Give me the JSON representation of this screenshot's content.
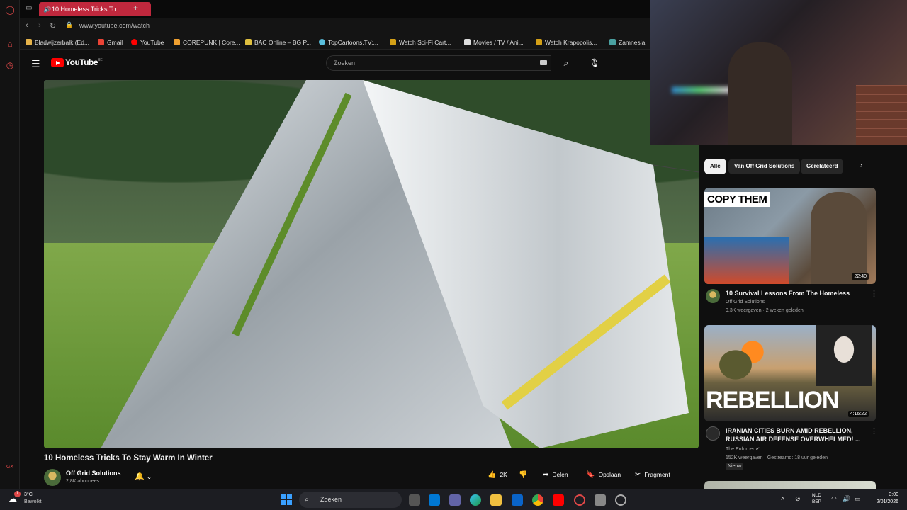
{
  "browser": {
    "tab_title": "10 Homeless Tricks To",
    "url": "www.youtube.com/watch",
    "bookmarks": [
      {
        "label": "Bladwijzerbalk (Ed...",
        "color": "#e6b34a"
      },
      {
        "label": "Gmail",
        "color": "#ea4335"
      },
      {
        "label": "YouTube",
        "color": "#ff0000"
      },
      {
        "label": "COREPUNK | Core...",
        "color": "#f0a030"
      },
      {
        "label": "BAC Online – BG P...",
        "color": "#e0c040"
      },
      {
        "label": "TopCartoons.TV:...",
        "color": "#5bc0de"
      },
      {
        "label": "Watch Sci-Fi Cart...",
        "color": "#d4a017"
      },
      {
        "label": "Movies / TV / Ani...",
        "color": "#dddddd"
      },
      {
        "label": "Watch Krapopolis...",
        "color": "#d4a017"
      },
      {
        "label": "Zamnesia",
        "color": "#4aa0a0"
      }
    ]
  },
  "youtube": {
    "logo_text": "YouTube",
    "country_code": "BE",
    "search_placeholder": "Zoeken"
  },
  "video": {
    "title": "10 Homeless Tricks To Stay Warm In Winter",
    "channel_name": "Off Grid Solutions",
    "channel_subs": "2,8K abonnees",
    "like_count": "2K",
    "share_label": "Delen",
    "save_label": "Opslaan",
    "clip_label": "Fragment",
    "more_label": "···"
  },
  "chips": [
    {
      "label": "Alle",
      "active": true
    },
    {
      "label": "Van Off Grid Solutions",
      "active": false
    },
    {
      "label": "Gerelateerd",
      "active": false
    }
  ],
  "recommendations": [
    {
      "title": "10 Survival Lessons From The Homeless",
      "channel": "Off Grid Solutions",
      "meta": "9,3K weergaven · 2 weken geleden",
      "duration": "22:40",
      "thumb_text": "COPY THEM"
    },
    {
      "title": "IRANIAN CITIES BURN AMID REBELLION, RUSSIAN AIR DEFENSE OVERWHELMED! ...",
      "channel": "The Enforcer",
      "meta": "152K weergaven · Gestreamd: 18 uur geleden",
      "badge": "Nieuw",
      "duration": "4:16:22",
      "thumb_text": "REBELLION"
    }
  ],
  "taskbar": {
    "weather_temp": "3°C",
    "weather_desc": "Bewolkt",
    "weather_badge": "1",
    "search_label": "Zoeken",
    "lang_top": "NLD",
    "lang_bottom": "BEP",
    "time": "3:00",
    "date": "2/01/2026"
  },
  "colors": {
    "tab_accent": "#c0283d",
    "youtube_red": "#ff0000",
    "windows_blue": "#3aa0ff"
  }
}
